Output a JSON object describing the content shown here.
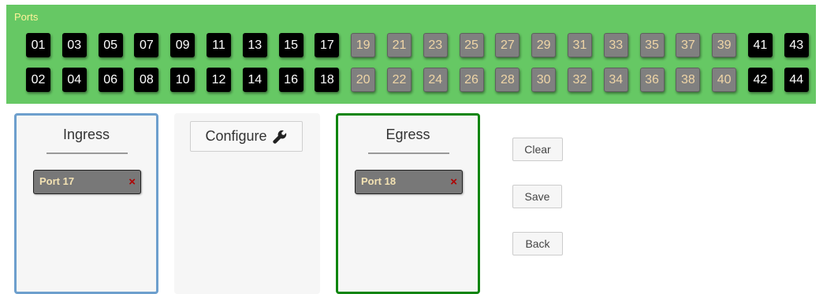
{
  "ports_panel": {
    "title": "Ports",
    "top_row": [
      {
        "label": "01",
        "state": "active"
      },
      {
        "label": "03",
        "state": "active"
      },
      {
        "label": "05",
        "state": "active"
      },
      {
        "label": "07",
        "state": "active"
      },
      {
        "label": "09",
        "state": "active"
      },
      {
        "label": "11",
        "state": "active"
      },
      {
        "label": "13",
        "state": "active"
      },
      {
        "label": "15",
        "state": "active"
      },
      {
        "label": "17",
        "state": "active"
      },
      {
        "label": "19",
        "state": "inactive"
      },
      {
        "label": "21",
        "state": "inactive"
      },
      {
        "label": "23",
        "state": "inactive"
      },
      {
        "label": "25",
        "state": "inactive"
      },
      {
        "label": "27",
        "state": "inactive"
      },
      {
        "label": "29",
        "state": "inactive"
      },
      {
        "label": "31",
        "state": "inactive"
      },
      {
        "label": "33",
        "state": "inactive"
      },
      {
        "label": "35",
        "state": "inactive"
      },
      {
        "label": "37",
        "state": "inactive"
      },
      {
        "label": "39",
        "state": "inactive"
      },
      {
        "label": "41",
        "state": "active"
      },
      {
        "label": "43",
        "state": "active"
      }
    ],
    "bottom_row": [
      {
        "label": "02",
        "state": "active"
      },
      {
        "label": "04",
        "state": "active"
      },
      {
        "label": "06",
        "state": "active"
      },
      {
        "label": "08",
        "state": "active"
      },
      {
        "label": "10",
        "state": "active"
      },
      {
        "label": "12",
        "state": "active"
      },
      {
        "label": "14",
        "state": "active"
      },
      {
        "label": "16",
        "state": "active"
      },
      {
        "label": "18",
        "state": "active"
      },
      {
        "label": "20",
        "state": "inactive"
      },
      {
        "label": "22",
        "state": "inactive"
      },
      {
        "label": "24",
        "state": "inactive"
      },
      {
        "label": "26",
        "state": "inactive"
      },
      {
        "label": "28",
        "state": "inactive"
      },
      {
        "label": "30",
        "state": "inactive"
      },
      {
        "label": "32",
        "state": "inactive"
      },
      {
        "label": "34",
        "state": "inactive"
      },
      {
        "label": "36",
        "state": "inactive"
      },
      {
        "label": "38",
        "state": "inactive"
      },
      {
        "label": "40",
        "state": "inactive"
      },
      {
        "label": "42",
        "state": "active"
      },
      {
        "label": "44",
        "state": "active"
      }
    ]
  },
  "ingress": {
    "title": "Ingress",
    "ports": [
      {
        "label": "Port 17",
        "remove_icon": "×"
      }
    ]
  },
  "configure": {
    "button_label": "Configure",
    "icon": "wrench-icon"
  },
  "egress": {
    "title": "Egress",
    "ports": [
      {
        "label": "Port 18",
        "remove_icon": "×"
      }
    ]
  },
  "actions": {
    "clear_label": "Clear",
    "save_label": "Save",
    "back_label": "Back"
  },
  "colors": {
    "panel_bg": "#66c864",
    "port_active_bg": "#000000",
    "port_inactive_bg": "#808080",
    "ingress_border": "#6d9fcd",
    "egress_border": "#0f850f",
    "remove_icon": "#b00000"
  }
}
